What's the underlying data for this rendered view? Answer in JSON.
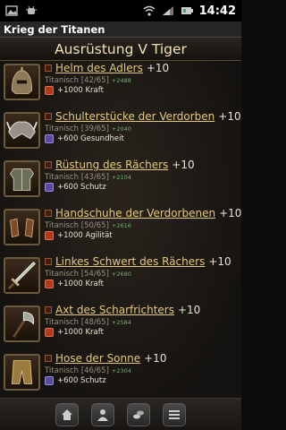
{
  "status_bar": {
    "time": "14:42",
    "left_icons": [
      "image-icon",
      "android-debug-icon"
    ],
    "right_icons": [
      "wifi-icon",
      "signal-icon",
      "battery-icon"
    ]
  },
  "app_title": "Krieg der Titanen",
  "section_title": "Ausrüstung V Tiger",
  "items": [
    {
      "name": "Helm des Adlers",
      "plus": "+10",
      "material": "Titanisch [42/65]",
      "power": "+2488",
      "bonus": "+1000 Kraft",
      "bonus_color": "red",
      "icon": "helmet-icon"
    },
    {
      "name": "Schulterstücke der Verdorben",
      "plus": "+10",
      "material": "Titanisch [39/65]",
      "power": "+2040",
      "bonus": "+600 Gesundheit",
      "bonus_color": "purple",
      "icon": "shoulder-armor-icon"
    },
    {
      "name": "Rüstung des Rächers",
      "plus": "+10",
      "material": "Titanisch [43/65]",
      "power": "+2104",
      "bonus": "+600 Schutz",
      "bonus_color": "purple",
      "icon": "chest-armor-icon"
    },
    {
      "name": "Handschuhe der Verdorbenen",
      "plus": "+10",
      "material": "Titanisch [50/65]",
      "power": "+2616",
      "bonus": "+1000 Agilität",
      "bonus_color": "red",
      "icon": "gloves-icon"
    },
    {
      "name": "Linkes Schwert des Rächers",
      "plus": "+10",
      "material": "Titanisch [54/65]",
      "power": "+2680",
      "bonus": "+1000 Kraft",
      "bonus_color": "red",
      "icon": "sword-icon"
    },
    {
      "name": "Axt des Scharfrichters",
      "plus": "+10",
      "material": "Titanisch [48/65]",
      "power": "+2584",
      "bonus": "+1000 Kraft",
      "bonus_color": "red",
      "icon": "axe-icon"
    },
    {
      "name": "Hose der Sonne",
      "plus": "+10",
      "material": "Titanisch [46/65]",
      "power": "+2304",
      "bonus": "+600 Schutz",
      "bonus_color": "purple",
      "icon": "pants-icon"
    }
  ],
  "bottom_nav": [
    "home-icon",
    "profile-icon",
    "coins-icon",
    "menu-icon"
  ]
}
